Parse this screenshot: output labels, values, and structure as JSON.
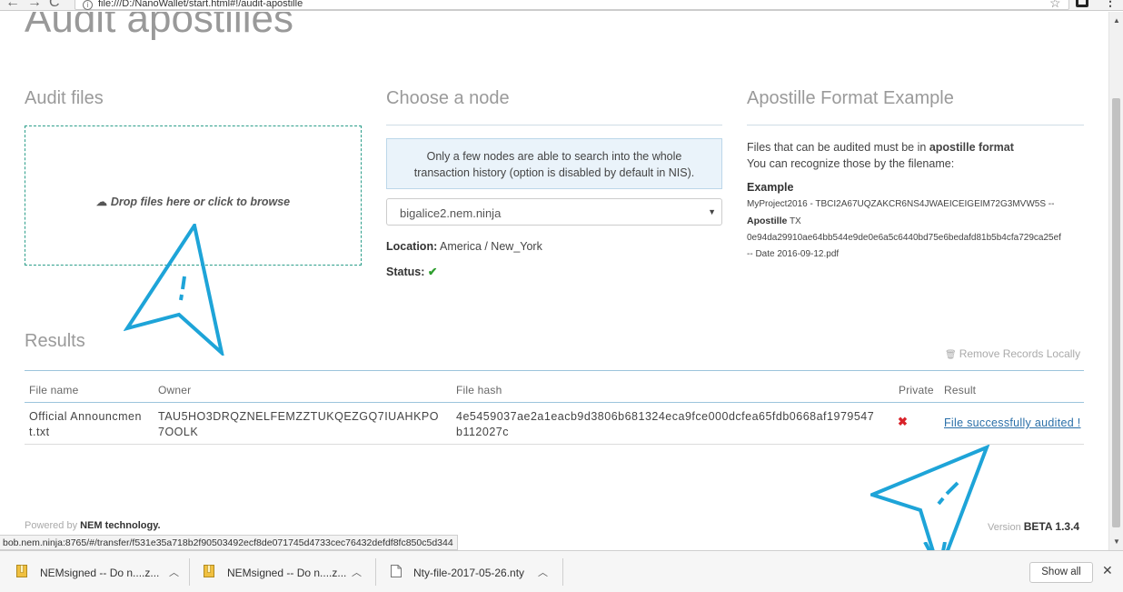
{
  "browser": {
    "url": "file:///D:/NanoWallet/start.html#!/audit-apostille",
    "info_glyph": "i"
  },
  "page": {
    "title": "Audit apostilles"
  },
  "audit_files": {
    "heading": "Audit files",
    "drop_label": "Drop files here or click to browse",
    "drop_icon": "cloud-upload-icon"
  },
  "node": {
    "heading": "Choose a node",
    "info": "Only a few nodes are able to search into the whole transaction history (option is disabled by default in NIS).",
    "selected": "bigalice2.nem.ninja",
    "location_label": "Location:",
    "location_value": "America / New_York",
    "status_label": "Status:",
    "status_icon": "check-icon",
    "status_color": "#2e9e2e"
  },
  "format_example": {
    "heading": "Apostille Format Example",
    "line1_pre": "Files that can be audited must be in ",
    "line1_bold": "apostille format",
    "line2": "You can recognize those by the filename:",
    "example_label": "Example",
    "example_line1": "MyProject2016 - TBCI2A67UQZAKCR6NS4JWAEICEIGEIM72G3MVW5S --",
    "example_apostille": "Apostille",
    "example_tx": " TX",
    "example_hash": "0e94da29910ae64bb544e9de0e6a5c6440bd75e6bedafd81b5b4cfa729ca25ef",
    "example_date": "-- Date 2016-09-12.pdf"
  },
  "results": {
    "heading": "Results",
    "remove_label": "Remove Records Locally",
    "columns": [
      "File name",
      "Owner",
      "File hash",
      "Private",
      "Result"
    ],
    "rows": [
      {
        "file_name_1": "Official Announcmen",
        "file_name_2": "t.txt",
        "owner_1": "TAU5HO3DRQZNELFEMZZTUKQEZGQ7IUAHKPO",
        "owner_2": "7OOLK",
        "hash_1": "4e5459037ae2a1eacb9d3806b681324eca9fce000dcfea65fdb0668af1979547",
        "hash_2": "b112027c",
        "private_icon": "x-icon",
        "private_color": "#d9232a",
        "result": "File successfully audited !"
      }
    ]
  },
  "footer": {
    "powered_pre": "Powered by ",
    "powered_bold": "NEM technology.",
    "version_label": "Version ",
    "version_value": "BETA 1.3.4"
  },
  "status_url": "bob.nem.ninja:8765/#/transfer/f531e35a718b2f90503492ecf8de071745d4733cec76432defdf8fc850c5d344",
  "downloads": [
    {
      "name": "NEMsigned -- Do n....z..."
    },
    {
      "name": "NEMsigned -- Do n....z..."
    },
    {
      "name": "Nty-file-2017-05-26.nty"
    }
  ],
  "shelf": {
    "show_all": "Show all"
  },
  "colors": {
    "accent_teal": "#2c9e8a",
    "link_blue": "#2a6fa8",
    "annotation_arrow": "#1ea4d8"
  }
}
